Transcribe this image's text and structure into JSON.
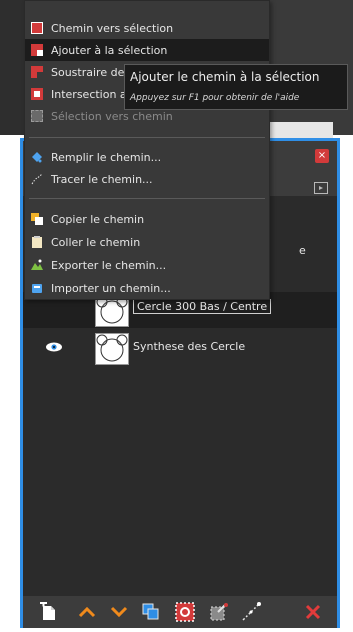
{
  "menu": {
    "items": [
      {
        "label": "Chemin vers sélection",
        "icon": "path-to-selection-icon",
        "enabled": true
      },
      {
        "label": "Ajouter à la sélection",
        "icon": "add-to-selection-icon",
        "enabled": true,
        "highlighted": true
      },
      {
        "label": "Soustraire de l",
        "icon": "subtract-selection-icon",
        "enabled": true
      },
      {
        "label": "Intersection av",
        "icon": "intersect-selection-icon",
        "enabled": true
      },
      {
        "label": "Sélection vers chemin",
        "icon": "selection-to-path-icon",
        "enabled": false
      },
      {
        "label": "Remplir le chemin...",
        "icon": "fill-path-icon",
        "enabled": true
      },
      {
        "label": "Tracer le chemin...",
        "icon": "stroke-path-icon",
        "enabled": true
      },
      {
        "label": "Copier le chemin",
        "icon": "copy-path-icon",
        "enabled": true
      },
      {
        "label": "Coller le chemin",
        "icon": "paste-path-icon",
        "enabled": true
      },
      {
        "label": "Exporter le chemin...",
        "icon": "export-path-icon",
        "enabled": true
      },
      {
        "label": "Importer un chemin...",
        "icon": "import-path-icon",
        "enabled": true
      }
    ]
  },
  "tooltip": {
    "title": "Ajouter le chemin à la sélection",
    "hint": "Appuyez sur F1 pour obtenir de l'aide"
  },
  "paths_panel": {
    "fragment": "e",
    "rows": [
      {
        "name": "Cercle 300 Bas / Centre",
        "selected": true,
        "visible": false
      },
      {
        "name": "Synthese des Cercle",
        "selected": false,
        "visible": true
      }
    ],
    "footer_buttons": [
      {
        "icon": "new-path-icon"
      },
      {
        "icon": "raise-path-icon"
      },
      {
        "icon": "lower-path-icon"
      },
      {
        "icon": "duplicate-path-icon"
      },
      {
        "icon": "path-to-selection-icon"
      },
      {
        "icon": "selection-to-path-icon"
      },
      {
        "icon": "paint-along-path-icon"
      },
      {
        "icon": "delete-path-icon"
      }
    ]
  },
  "colors": {
    "dock_border": "#2f8ee6",
    "menu_bg": "#393939",
    "highlight": "#1c1c1c",
    "red_icon": "#d23a3a",
    "orange_arrow": "#f08a1c"
  }
}
